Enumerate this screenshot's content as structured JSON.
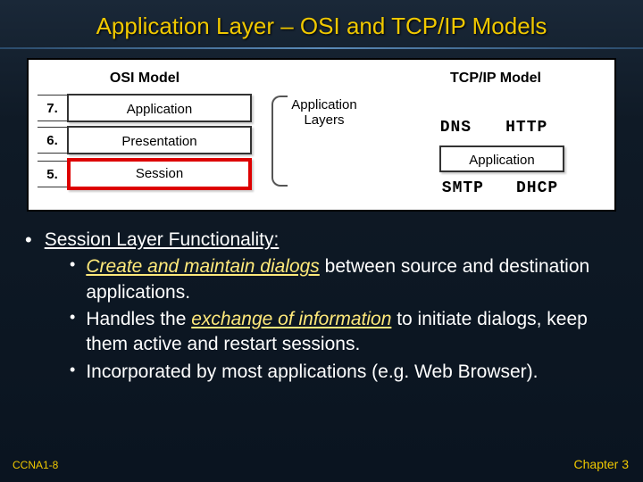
{
  "title": "Application Layer – OSI and TCP/IP Models",
  "diagram": {
    "osi_header": "OSI Model",
    "tcp_header": "TCP/IP Model",
    "rows": {
      "r7": {
        "num": "7.",
        "label": "Application"
      },
      "r6": {
        "num": "6.",
        "label": "Presentation"
      },
      "r5": {
        "num": "5.",
        "label": "Session"
      }
    },
    "mid_label_l1": "Application",
    "mid_label_l2": "Layers",
    "proto": {
      "dns": "DNS",
      "http": "HTTP",
      "smtp": "SMTP",
      "dhcp": "DHCP"
    },
    "tcp_app": "Application"
  },
  "bullets": {
    "heading": "Session Layer Functionality:",
    "p1_em": "Create and maintain dialogs",
    "p1_rest": " between source and destination applications.",
    "p2_pre": "Handles the ",
    "p2_em": "exchange of information",
    "p2_rest": " to initiate dialogs, keep them active and restart sessions.",
    "p3": "Incorporated by most applications (e.g. Web Browser)."
  },
  "footer": {
    "left": "CCNA1-8",
    "right": "Chapter 3"
  }
}
